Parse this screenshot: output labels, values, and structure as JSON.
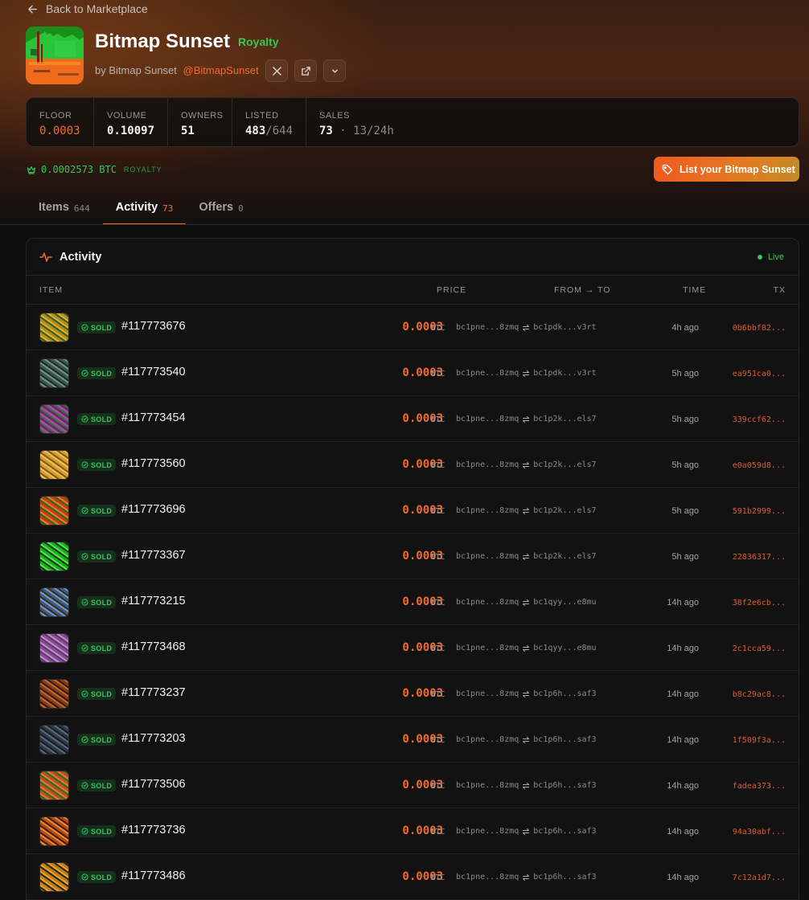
{
  "nav": {
    "back_label": "Back to Marketplace"
  },
  "collection": {
    "name": "Bitmap Sunset",
    "royalty_tag": "Royalty",
    "by_prefix": "by Bitmap Sunset",
    "handle": "@BitmapSunset"
  },
  "icons": {
    "back": "arrow-left-icon",
    "x": "x-logo-icon",
    "external": "external-link-icon",
    "more": "chevron-down-icon",
    "tag": "tag-icon",
    "crown": "crown-icon",
    "activity": "activity-pulse-icon",
    "sold": "check-circle-icon",
    "transfer": "swap-arrows-icon"
  },
  "stats": {
    "floor": {
      "label": "FLOOR",
      "value": "0.0003"
    },
    "volume": {
      "label": "VOLUME",
      "value": "0.10097"
    },
    "owners": {
      "label": "OWNERS",
      "value": "51"
    },
    "listed": {
      "label": "LISTED",
      "value": "483",
      "total": "/644"
    },
    "sales": {
      "label": "SALES",
      "value": "73",
      "sep": "·",
      "day": "13/24h"
    }
  },
  "royalty": {
    "amount": "0.0002573 BTC",
    "label": "ROYALTY"
  },
  "list_button_label": "List your Bitmap Sunset",
  "tabs": [
    {
      "label": "Items",
      "count": "644"
    },
    {
      "label": "Activity",
      "count": "73"
    },
    {
      "label": "Offers",
      "count": "0"
    }
  ],
  "activity": {
    "title": "Activity",
    "live_label": "Live",
    "columns": {
      "item": "ITEM",
      "price": "PRICE",
      "from_to": "FROM → TO",
      "time": "TIME",
      "tx": "TX"
    },
    "rows": [
      {
        "status": "SOLD",
        "id": "#117773676",
        "price": "0.0003",
        "unit": "BTC",
        "from": "bc1pne...8zmq",
        "to": "bc1pdk...v3rt",
        "time": "4h ago",
        "tx": "0b6bbf82..."
      },
      {
        "status": "SOLD",
        "id": "#117773540",
        "price": "0.0003",
        "unit": "BTC",
        "from": "bc1pne...8zmq",
        "to": "bc1pdk...v3rt",
        "time": "5h ago",
        "tx": "ea951ca0..."
      },
      {
        "status": "SOLD",
        "id": "#117773454",
        "price": "0.0003",
        "unit": "BTC",
        "from": "bc1pne...8zmq",
        "to": "bc1p2k...els7",
        "time": "5h ago",
        "tx": "339ccf62..."
      },
      {
        "status": "SOLD",
        "id": "#117773560",
        "price": "0.0003",
        "unit": "BTC",
        "from": "bc1pne...8zmq",
        "to": "bc1p2k...els7",
        "time": "5h ago",
        "tx": "e0a059d8..."
      },
      {
        "status": "SOLD",
        "id": "#117773696",
        "price": "0.0003",
        "unit": "BTC",
        "from": "bc1pne...8zmq",
        "to": "bc1p2k...els7",
        "time": "5h ago",
        "tx": "591b2999..."
      },
      {
        "status": "SOLD",
        "id": "#117773367",
        "price": "0.0003",
        "unit": "BTC",
        "from": "bc1pne...8zmq",
        "to": "bc1p2k...els7",
        "time": "5h ago",
        "tx": "22836317..."
      },
      {
        "status": "SOLD",
        "id": "#117773215",
        "price": "0.0003",
        "unit": "BTC",
        "from": "bc1pne...8zmq",
        "to": "bc1qyy...e8mu",
        "time": "14h ago",
        "tx": "38f2e6cb..."
      },
      {
        "status": "SOLD",
        "id": "#117773468",
        "price": "0.0003",
        "unit": "BTC",
        "from": "bc1pne...8zmq",
        "to": "bc1qyy...e8mu",
        "time": "14h ago",
        "tx": "2c1cca59..."
      },
      {
        "status": "SOLD",
        "id": "#117773237",
        "price": "0.0003",
        "unit": "BTC",
        "from": "bc1pne...8zmq",
        "to": "bc1p6h...saf3",
        "time": "14h ago",
        "tx": "b8c29ac8..."
      },
      {
        "status": "SOLD",
        "id": "#117773203",
        "price": "0.0003",
        "unit": "BTC",
        "from": "bc1pne...8zmq",
        "to": "bc1p6h...saf3",
        "time": "14h ago",
        "tx": "1f509f3a..."
      },
      {
        "status": "SOLD",
        "id": "#117773506",
        "price": "0.0003",
        "unit": "BTC",
        "from": "bc1pne...8zmq",
        "to": "bc1p6h...saf3",
        "time": "14h ago",
        "tx": "fadea373..."
      },
      {
        "status": "SOLD",
        "id": "#117773736",
        "price": "0.0003",
        "unit": "BTC",
        "from": "bc1pne...8zmq",
        "to": "bc1p6h...saf3",
        "time": "14h ago",
        "tx": "94a30abf..."
      },
      {
        "status": "SOLD",
        "id": "#117773486",
        "price": "0.0003",
        "unit": "BTC",
        "from": "bc1pne...8zmq",
        "to": "bc1p6h...saf3",
        "time": "14h ago",
        "tx": "7c12a1d7..."
      }
    ]
  },
  "colors": {
    "accent": "#f26a2e",
    "success": "#34c759",
    "background": "#0e0e0e"
  }
}
